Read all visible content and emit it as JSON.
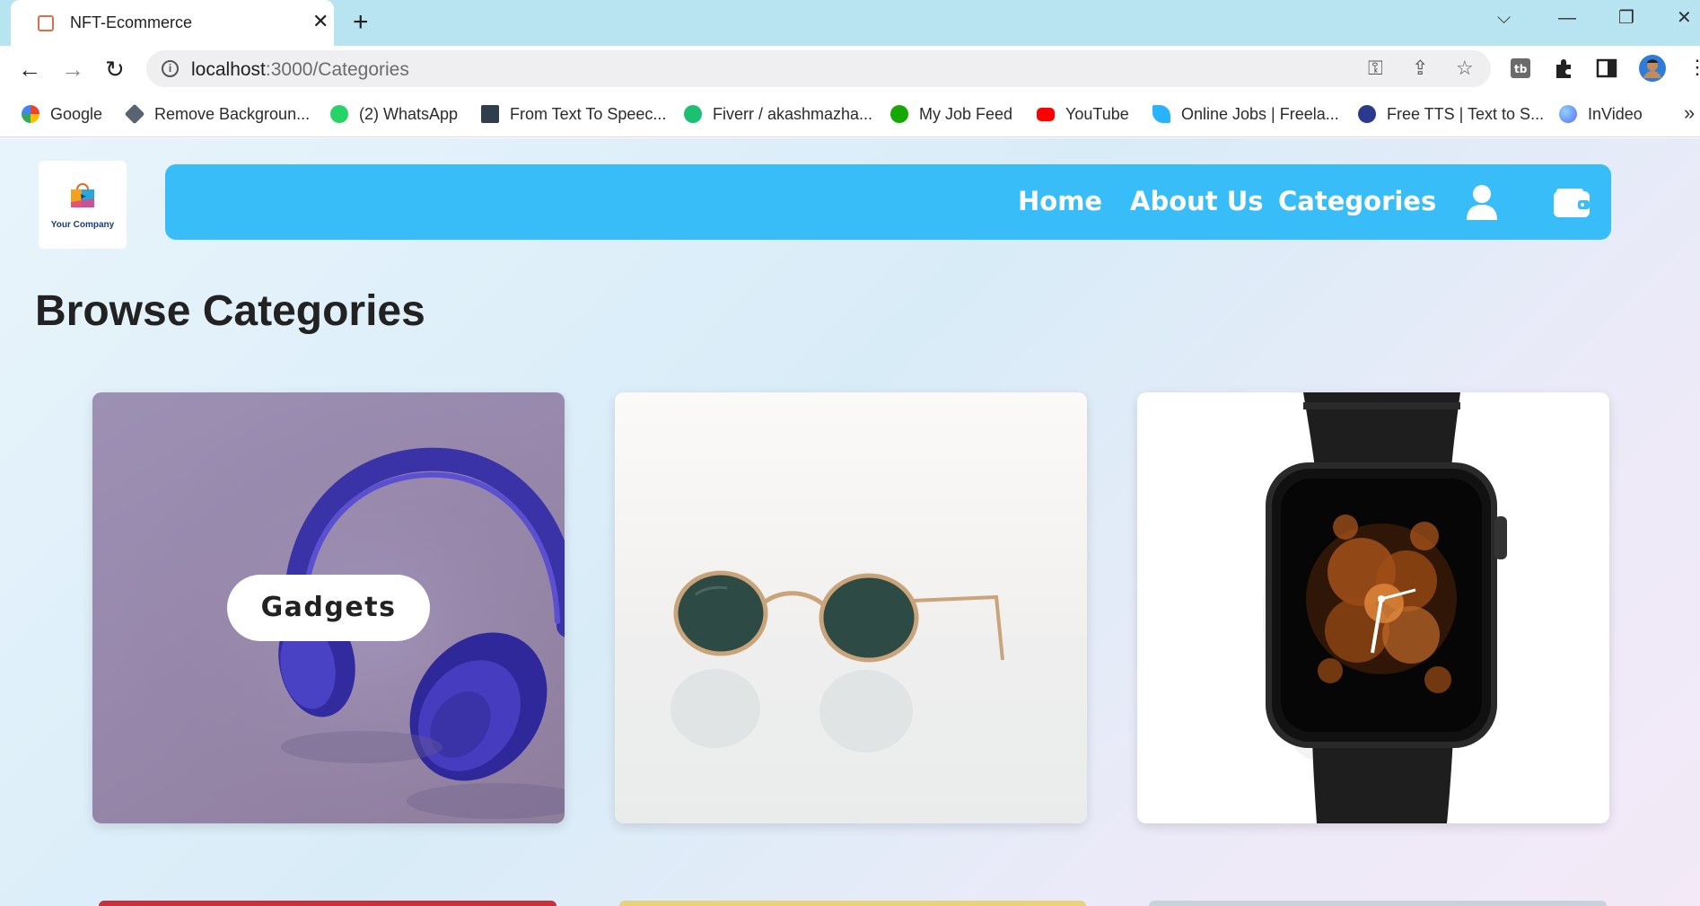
{
  "browser": {
    "tab_title": "NFT-Ecommerce",
    "url_host": "localhost",
    "url_path": ":3000/Categories",
    "bookmarks": [
      {
        "label": "Google",
        "color": "#4285f4"
      },
      {
        "label": "Remove Backgroun...",
        "color": "#5a6470"
      },
      {
        "label": "(2) WhatsApp",
        "color": "#25d366"
      },
      {
        "label": "From Text To Speec...",
        "color": "#2f3e4a"
      },
      {
        "label": "Fiverr / akashmazha...",
        "color": "#1dbf73"
      },
      {
        "label": "My Job Feed",
        "color": "#14a800"
      },
      {
        "label": "YouTube",
        "color": "#ff0000"
      },
      {
        "label": "Online Jobs | Freela...",
        "color": "#29b2fe"
      },
      {
        "label": "Free TTS | Text to S...",
        "color": "#2b3a8c"
      },
      {
        "label": "InVideo",
        "color": "#5b6cf2"
      }
    ]
  },
  "site": {
    "logo_text": "Your Company",
    "nav": {
      "home": "Home",
      "about": "About Us",
      "categories": "Categories"
    },
    "accent_color": "#38bdf8"
  },
  "main": {
    "title": "Browse Categories",
    "cards": [
      {
        "label": "Gadgets",
        "image": "headphones"
      },
      {
        "label": "",
        "image": "sunglasses"
      },
      {
        "label": "",
        "image": "smartwatch"
      }
    ]
  }
}
